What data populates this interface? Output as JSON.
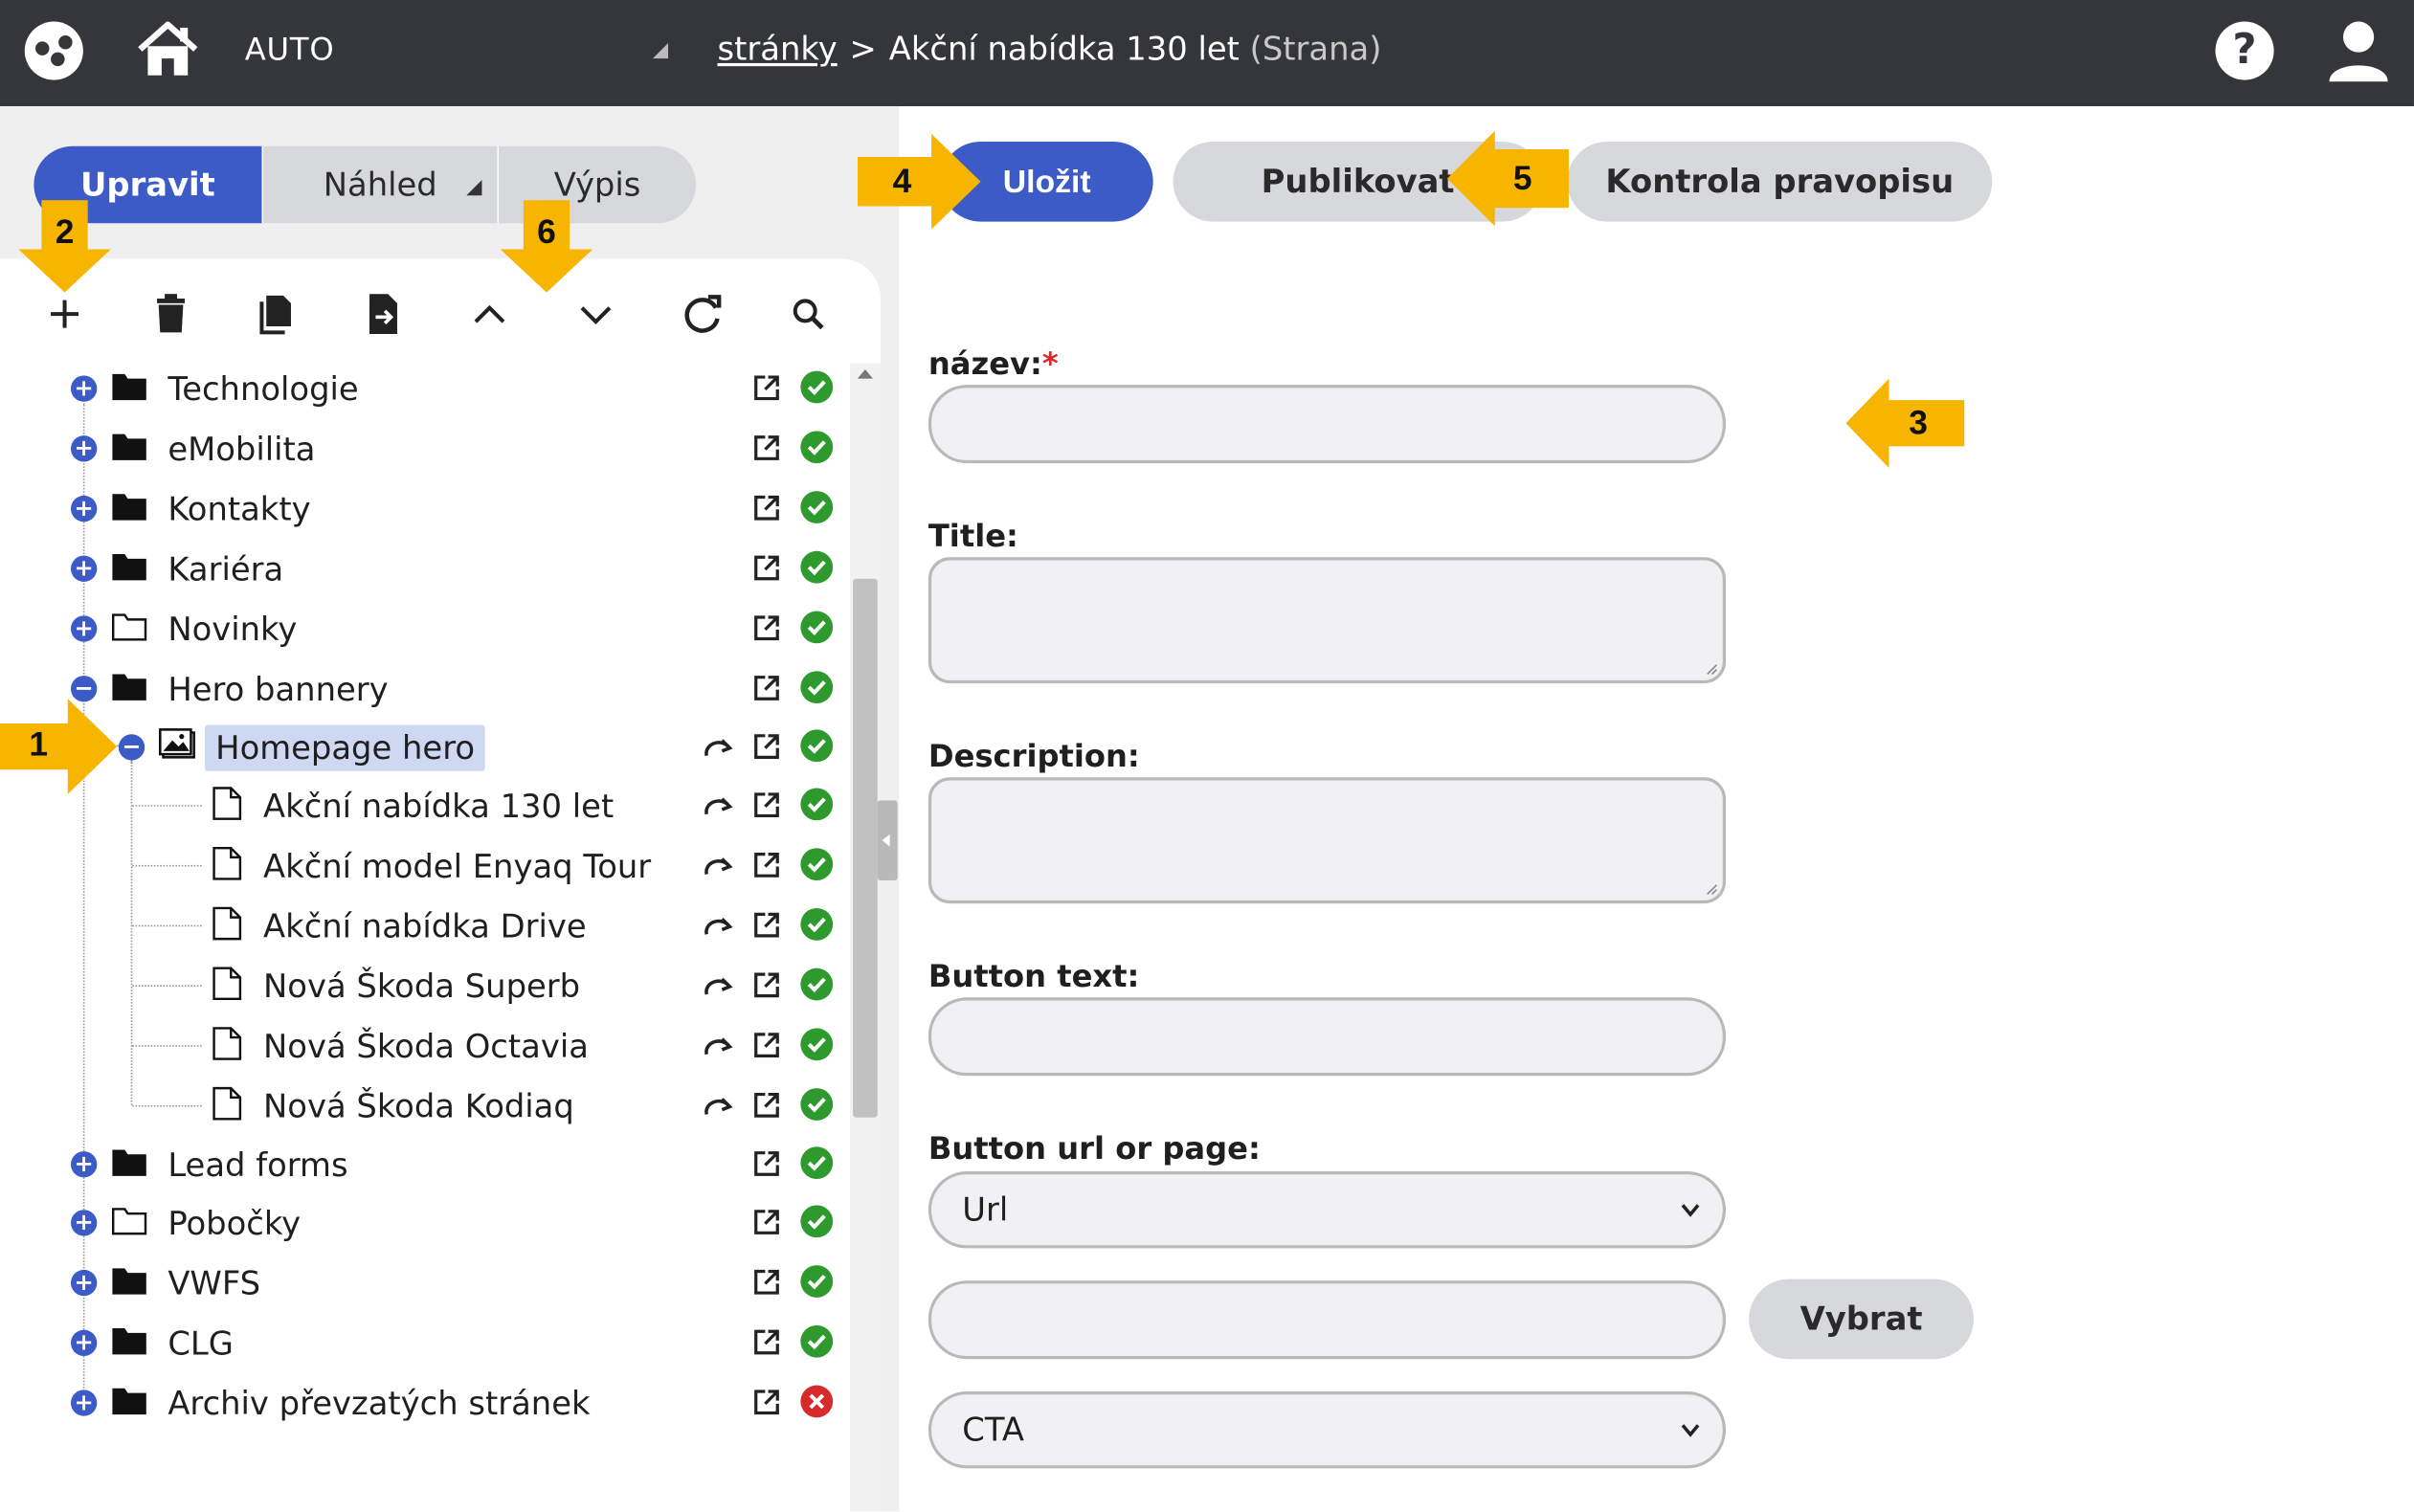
{
  "header": {
    "app_name": "AUTO",
    "breadcrumb_link": "stránky",
    "breadcrumb_separator": ">",
    "breadcrumb_current": "Akční nabídka 130 let",
    "breadcrumb_type": "(Strana)",
    "help_label": "?"
  },
  "left_tabs": [
    {
      "label": "Upravit"
    },
    {
      "label": "Náhled"
    },
    {
      "label": "Výpis"
    }
  ],
  "toolbar_icons": [
    "add-icon",
    "delete-icon",
    "copy-icon",
    "move-icon",
    "move-up-icon",
    "move-down-icon",
    "refresh-icon",
    "search-icon"
  ],
  "tree": {
    "items": [
      {
        "label": "Technologie",
        "state": "ok"
      },
      {
        "label": "eMobilita",
        "state": "ok"
      },
      {
        "label": "Kontakty",
        "state": "ok"
      },
      {
        "label": "Kariéra",
        "state": "ok"
      },
      {
        "label": "Novinky",
        "state": "ok"
      },
      {
        "label": "Hero bannery",
        "state": "ok"
      },
      {
        "label": "Homepage hero",
        "state": "ok"
      },
      {
        "label": "Akční nabídka 130 let",
        "state": "ok"
      },
      {
        "label": "Akční model Enyaq Tour",
        "state": "ok"
      },
      {
        "label": "Akční nabídka Drive",
        "state": "ok"
      },
      {
        "label": "Nová Škoda Superb",
        "state": "ok"
      },
      {
        "label": "Nová Škoda Octavia",
        "state": "ok"
      },
      {
        "label": "Nová Škoda Kodiaq",
        "state": "ok"
      },
      {
        "label": "Lead forms",
        "state": "ok"
      },
      {
        "label": "Pobočky",
        "state": "ok"
      },
      {
        "label": "VWFS",
        "state": "ok"
      },
      {
        "label": "CLG",
        "state": "ok"
      },
      {
        "label": "Archiv převzatých stránek",
        "state": "error"
      }
    ]
  },
  "actions": {
    "save": "Uložit",
    "publish": "Publikovat",
    "spellcheck": "Kontrola pravopisu"
  },
  "form": {
    "name_label": "název:",
    "name_required": "*",
    "name_value": "",
    "title_label": "Title:",
    "title_value": "",
    "description_label": "Description:",
    "description_value": "",
    "button_text_label": "Button text:",
    "button_text_value": "",
    "button_url_label": "Button url or page:",
    "url_type_selected": "Url",
    "url_value": "",
    "select_button": "Vybrat",
    "style_selected": "CTA"
  },
  "annotations": [
    "1",
    "2",
    "3",
    "4",
    "5",
    "6"
  ],
  "colors": {
    "topbar": "#34363b",
    "primary": "#3c5bc7",
    "annotation": "#f7b500",
    "ok": "#2e9a2e",
    "error": "#d72a2a"
  }
}
